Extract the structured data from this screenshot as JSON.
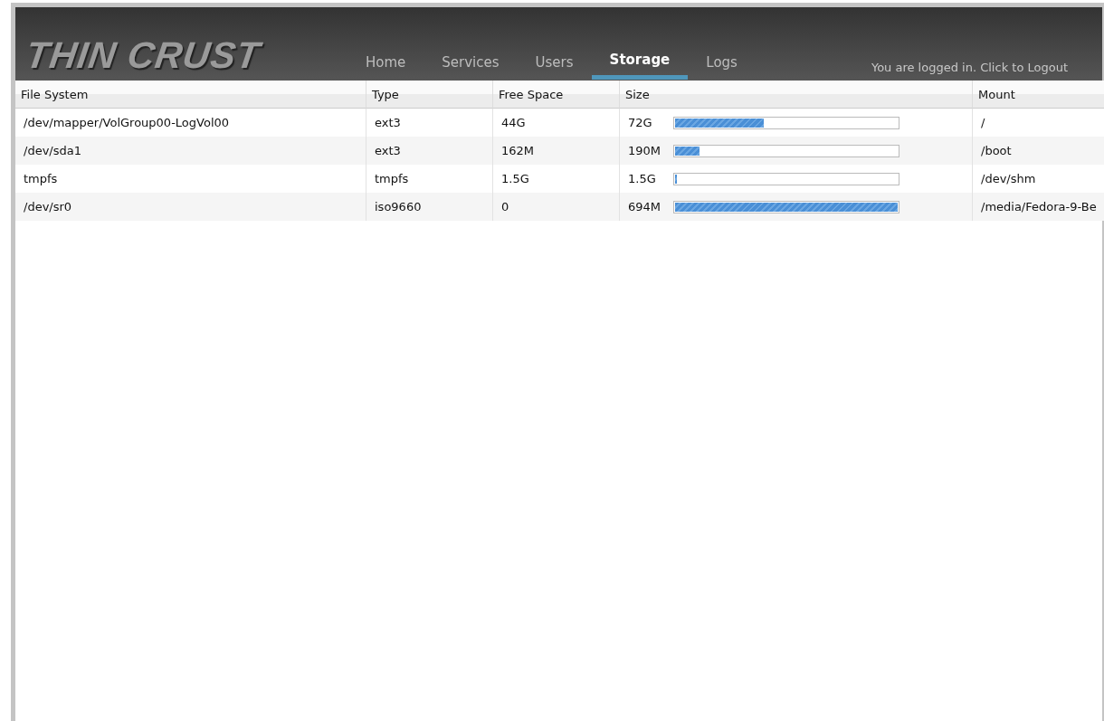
{
  "logo": "THIN CRUST",
  "nav": [
    {
      "label": "Home",
      "selected": false
    },
    {
      "label": "Services",
      "selected": false
    },
    {
      "label": "Users",
      "selected": false
    },
    {
      "label": "Storage",
      "selected": true
    },
    {
      "label": "Logs",
      "selected": false
    }
  ],
  "logout_link": "You are logged in. Click to Logout",
  "table": {
    "columns": [
      "File System",
      "Type",
      "Free Space",
      "Size",
      "Mount"
    ],
    "rows": [
      {
        "file_system": "/dev/mapper/VolGroup00-LogVol00",
        "type": "ext3",
        "free_space": "44G",
        "size": "72G",
        "level": 0.4,
        "mount": "/"
      },
      {
        "file_system": "/dev/sda1",
        "type": "ext3",
        "free_space": "162M",
        "size": "190M",
        "level": 0.11,
        "mount": "/boot"
      },
      {
        "file_system": "tmpfs",
        "type": "tmpfs",
        "free_space": "1.5G",
        "size": "1.5G",
        "level": 0.01,
        "mount": "/dev/shm"
      },
      {
        "file_system": "/dev/sr0",
        "type": "iso9660",
        "free_space": "0",
        "size": "694M",
        "level": 1.0,
        "mount": "/media/Fedora-9-Be"
      }
    ]
  }
}
